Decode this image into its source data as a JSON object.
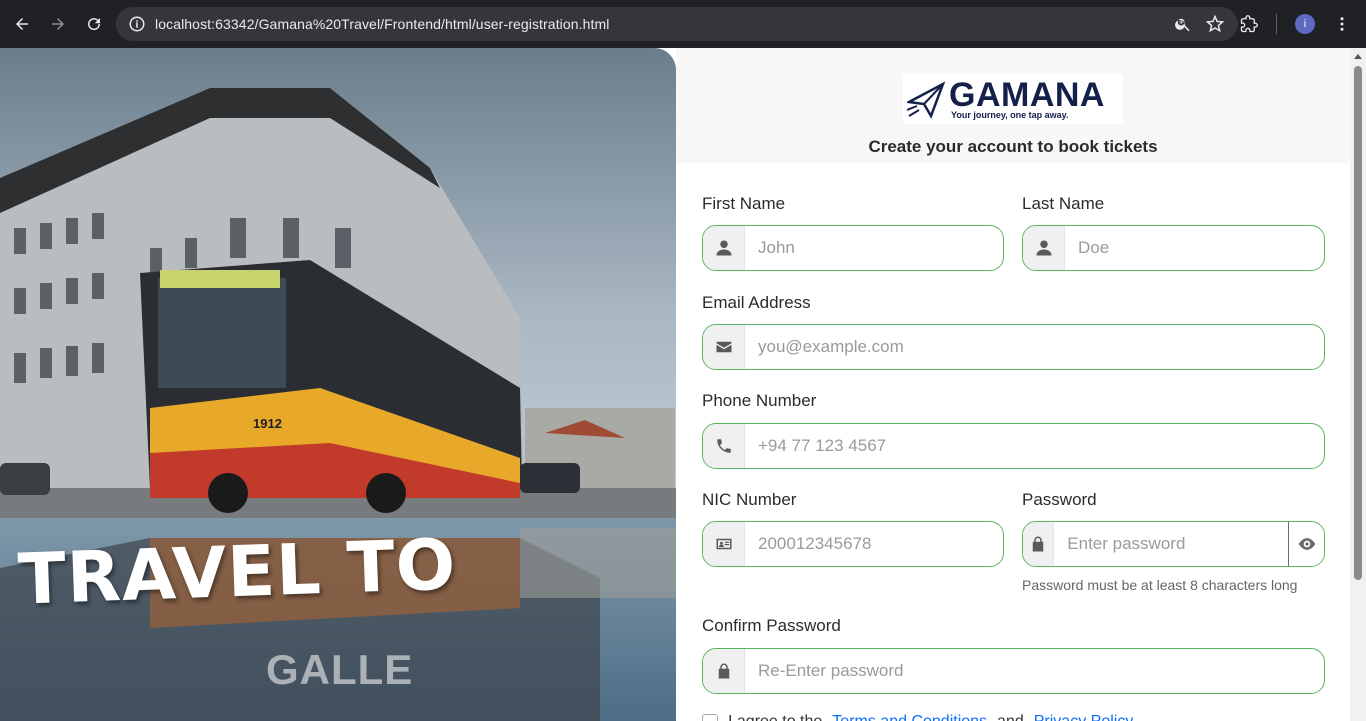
{
  "browser": {
    "url": "localhost:63342/Gamana%20Travel/Frontend/html/user-registration.html",
    "avatar_letter": "i"
  },
  "hero": {
    "line1": "TRAVEL TO",
    "line2": "GALLE",
    "bus_number": "1912"
  },
  "brand": {
    "name": "GAMANA",
    "tagline": "Your journey, one tap away.",
    "color": "#14204a"
  },
  "form": {
    "subtitle": "Create your account to book tickets",
    "accent": "#5bb55f",
    "first_name": {
      "label": "First Name",
      "placeholder": "John",
      "icon": "user-icon"
    },
    "last_name": {
      "label": "Last Name",
      "placeholder": "Doe",
      "icon": "user-icon"
    },
    "email": {
      "label": "Email Address",
      "placeholder": "you@example.com",
      "icon": "envelope-icon"
    },
    "phone": {
      "label": "Phone Number",
      "placeholder": "+94 77 123 4567",
      "icon": "phone-icon"
    },
    "nic": {
      "label": "NIC Number",
      "placeholder": "200012345678",
      "icon": "id-card-icon"
    },
    "password": {
      "label": "Password",
      "placeholder": "Enter password",
      "hint": "Password must be at least 8 characters long",
      "icon": "lock-icon"
    },
    "confirm_password": {
      "label": "Confirm Password",
      "placeholder": "Re-Enter password",
      "icon": "lock-icon"
    },
    "terms": {
      "prefix": "I agree to the",
      "link1": "Terms and Conditions",
      "middle": "and",
      "link2": "Privacy Policy"
    }
  }
}
